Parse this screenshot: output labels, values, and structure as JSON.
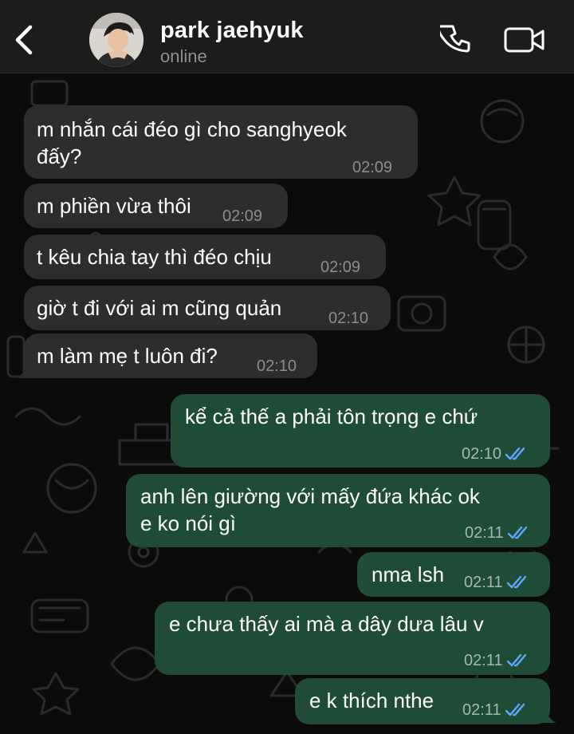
{
  "header": {
    "contact_name": "park jaehyuk",
    "status": "online"
  },
  "messages": [
    {
      "direction": "in",
      "lines": [
        "m nhắn cái đéo gì cho sanghyeok",
        "đấy?"
      ],
      "time": "02:09"
    },
    {
      "direction": "in",
      "lines": [
        "m phiền vừa thôi"
      ],
      "time": "02:09"
    },
    {
      "direction": "in",
      "lines": [
        "t kêu chia tay thì đéo chịu"
      ],
      "time": "02:09"
    },
    {
      "direction": "in",
      "lines": [
        "giờ t đi với ai m cũng quản"
      ],
      "time": "02:10"
    },
    {
      "direction": "in",
      "lines": [
        "m làm mẹ t luôn đi?"
      ],
      "time": "02:10"
    },
    {
      "direction": "out",
      "lines": [
        "kể cả thế a phải tôn trọng e chứ"
      ],
      "time": "02:10",
      "read": true
    },
    {
      "direction": "out",
      "lines": [
        "anh lên giường với mấy đứa khác ok",
        "e ko nói gì"
      ],
      "time": "02:11",
      "read": true
    },
    {
      "direction": "out",
      "lines": [
        "nma lsh"
      ],
      "time": "02:11",
      "read": true
    },
    {
      "direction": "out",
      "lines": [
        "e chưa thấy ai mà a dây dưa lâu v"
      ],
      "time": "02:11",
      "read": true
    },
    {
      "direction": "out",
      "lines": [
        "e k thích nthe"
      ],
      "time": "02:11",
      "read": true
    }
  ],
  "colors": {
    "header_bg": "#1c1c1d",
    "incoming_bubble": "#2d2d2f",
    "outgoing_bubble": "#1f4c37",
    "read_ticks": "#5fa8ff",
    "wallpaper_bg": "#0b0b0b"
  },
  "icons": {
    "back": "chevron-left-icon",
    "call": "phone-icon",
    "video": "video-camera-icon",
    "read_receipt": "double-check-icon"
  }
}
